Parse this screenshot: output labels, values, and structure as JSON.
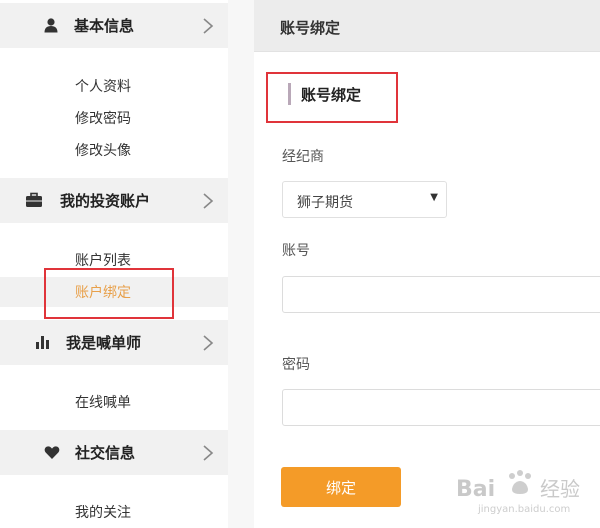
{
  "sidebar": {
    "sections": [
      {
        "title": "基本信息",
        "icon": "user-icon",
        "items": [
          "个人资料",
          "修改密码",
          "修改头像"
        ]
      },
      {
        "title": "我的投资账户",
        "icon": "briefcase-icon",
        "items": [
          "账户列表",
          "账户绑定"
        ],
        "active_item": "账户绑定"
      },
      {
        "title": "我是喊单师",
        "icon": "bar-chart-icon",
        "items": [
          "在线喊单"
        ]
      },
      {
        "title": "社交信息",
        "icon": "heart-icon",
        "items": [
          "我的关注"
        ]
      }
    ]
  },
  "main": {
    "header_title": "账号绑定",
    "section_title": "账号绑定",
    "broker_label": "经纪商",
    "broker_value": "狮子期货",
    "account_label": "账号",
    "account_value": "",
    "password_label": "密码",
    "password_value": "",
    "submit_label": "绑定"
  },
  "watermark": {
    "text": "Bai 经验",
    "subtext": "jingyan.baidu.com"
  },
  "colors": {
    "accent_orange": "#f49b28",
    "active_text": "#e8a04a",
    "annotation_red": "#e0343a",
    "header_gray": "#ececec"
  }
}
